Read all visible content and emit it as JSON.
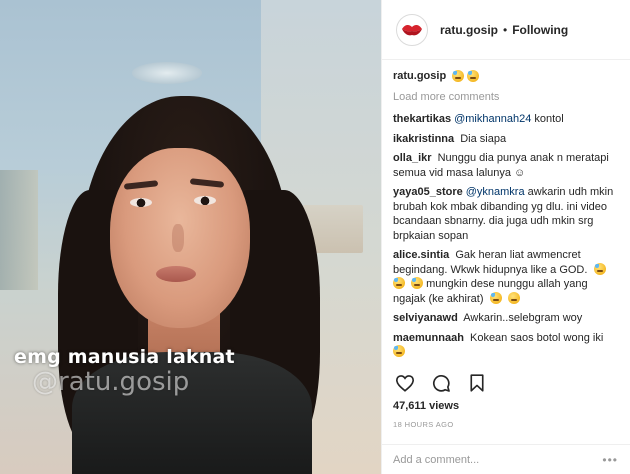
{
  "header": {
    "username": "ratu.gosip",
    "separator": "•",
    "follow_status": "Following",
    "avatar_icon": "red-lips-icon"
  },
  "media": {
    "overlay_text": "emg manusia laknat",
    "overlay_handle": "@ratu.gosip"
  },
  "caption": {
    "username": "ratu.gosip",
    "emojis": [
      "grimacing-emoji",
      "grimacing-emoji"
    ]
  },
  "comments_section": {
    "load_more": "Load more comments",
    "items": [
      {
        "user": "thekartikas",
        "mention": "@mikhannah24",
        "text": " kontol"
      },
      {
        "user": "ikakristinna",
        "mention": "",
        "text": "Dia siapa"
      },
      {
        "user": "olla_ikr",
        "mention": "",
        "text": "Nunggu dia punya anak n meratapi semua vid masa lalunya ☺"
      },
      {
        "user": "yaya05_store",
        "mention": "@yknamkra",
        "text": " awkarin udh mkin brubah kok mbak dibanding yg dlu. ini video bcandaan sbnarny. dia juga udh mkin srg brpkaian sopan"
      },
      {
        "user": "alice.sintia",
        "mention": "",
        "text": "Gak heran liat awmencret begindang. Wkwk hidupnya like a GOD."
      },
      {
        "user": "selviyanawd",
        "mention": "",
        "text": "Awkarin..selebgram woy"
      },
      {
        "user": "maemunnaah",
        "mention": "",
        "text": "Kokean saos botol wong iki"
      }
    ],
    "alice_continued": "mungkin dese nunggu allah yang ngajak (ke akhirat)"
  },
  "actions": {
    "like_icon": "heart-icon",
    "comment_icon": "comment-bubble-icon",
    "save_icon": "bookmark-icon"
  },
  "stats": {
    "views": "47,611 views",
    "timestamp": "18 HOURS AGO"
  },
  "add_comment": {
    "placeholder": "Add a comment...",
    "more": "•••"
  }
}
